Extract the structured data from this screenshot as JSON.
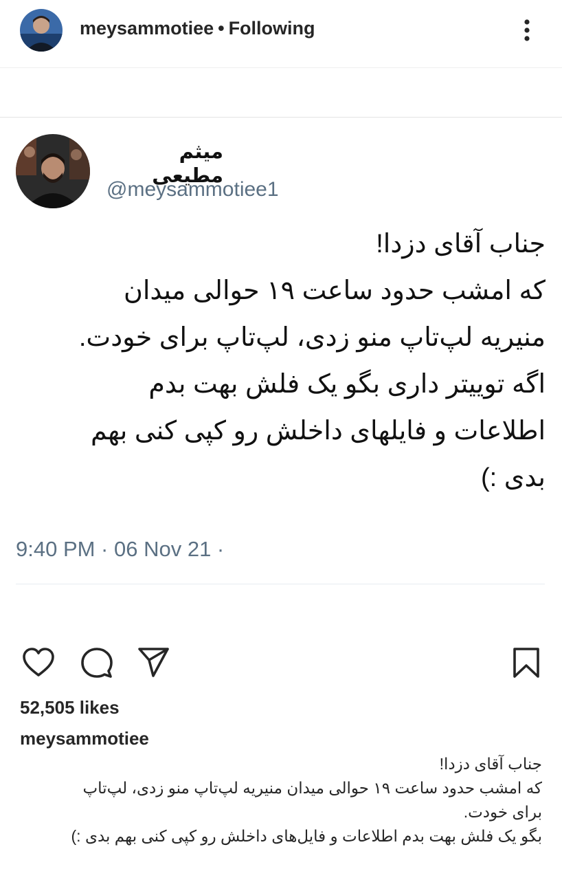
{
  "header": {
    "username": "meysammotiee",
    "separator": "•",
    "follow_status": "Following",
    "avatar_icon": "profile-photo",
    "more_icon": "more-vertical-icon"
  },
  "tweet": {
    "display_name": "میثم مطیعی",
    "handle": "@meysammotiee1",
    "lines": [
      "جناب آقای دزدا!",
      "که امشب حدود ساعت ۱۹ حوالی میدان",
      "منیریه لپ‌تاپ منو زدی، لپ‌تاپ برای خودت.",
      "اگه توییتر داری بگو یک فلش بهت بدم",
      "اطلاعات و فایلهای داخلش رو کپی کنی بهم",
      "بدی :)"
    ],
    "timestamp": "9:40 PM · 06 Nov 21 ·"
  },
  "actions": {
    "like_icon": "heart-icon",
    "comment_icon": "comment-icon",
    "share_icon": "send-icon",
    "save_icon": "bookmark-icon"
  },
  "likes": "52,505 likes",
  "caption": {
    "username": "meysammotiee",
    "lines": [
      "جناب آقای دزدا!",
      "که امشب حدود ساعت ۱۹ حوالی میدان منیریه لپ‌تاپ منو زدی، لپ‌تاپ",
      "برای خودت.",
      "بگو یک فلش بهت بدم اطلاعات و فایل‌های داخلش رو کپی کنی بهم بدی :)"
    ]
  }
}
